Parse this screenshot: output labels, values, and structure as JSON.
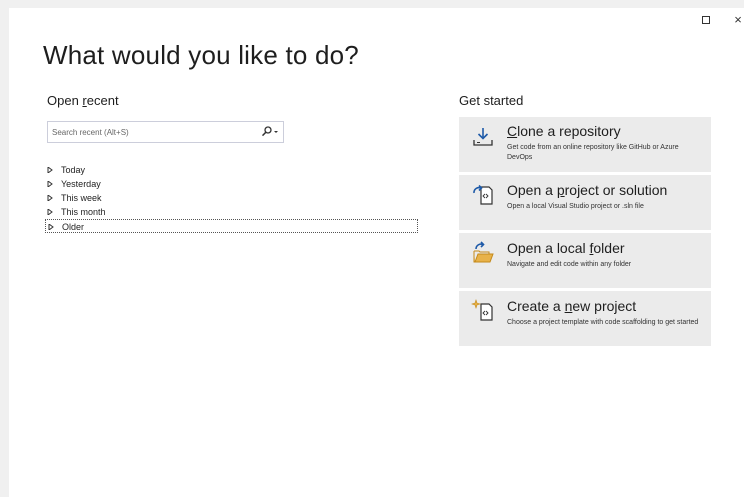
{
  "window": {
    "maximize_glyph": "",
    "close_glyph": "×"
  },
  "page_title": "What would you like to do?",
  "open_recent": {
    "title_before": "Open ",
    "title_underline": "r",
    "title_after": "ecent",
    "search": {
      "placeholder": "Search recent (Alt+S)",
      "value": ""
    },
    "groups": [
      {
        "label": "Today"
      },
      {
        "label": "Yesterday"
      },
      {
        "label": "This week"
      },
      {
        "label": "This month"
      },
      {
        "label": "Older"
      }
    ]
  },
  "get_started": {
    "title": "Get started",
    "cards": [
      {
        "icon": "clone-download-icon",
        "title_before": "",
        "title_underline": "C",
        "title_after": "lone a repository",
        "desc": "Get code from an online repository like GitHub or Azure DevOps"
      },
      {
        "icon": "open-project-icon",
        "title_before": "Open a ",
        "title_underline": "p",
        "title_after": "roject or solution",
        "desc": "Open a local Visual Studio project or .sln file"
      },
      {
        "icon": "open-folder-icon",
        "title_before": "Open a local ",
        "title_underline": "f",
        "title_after": "older",
        "desc": "Navigate and edit code within any folder"
      },
      {
        "icon": "new-project-icon",
        "title_before": "Create a ",
        "title_underline": "n",
        "title_after": "ew project",
        "desc": "Choose a project template with code scaffolding to get started"
      }
    ]
  }
}
